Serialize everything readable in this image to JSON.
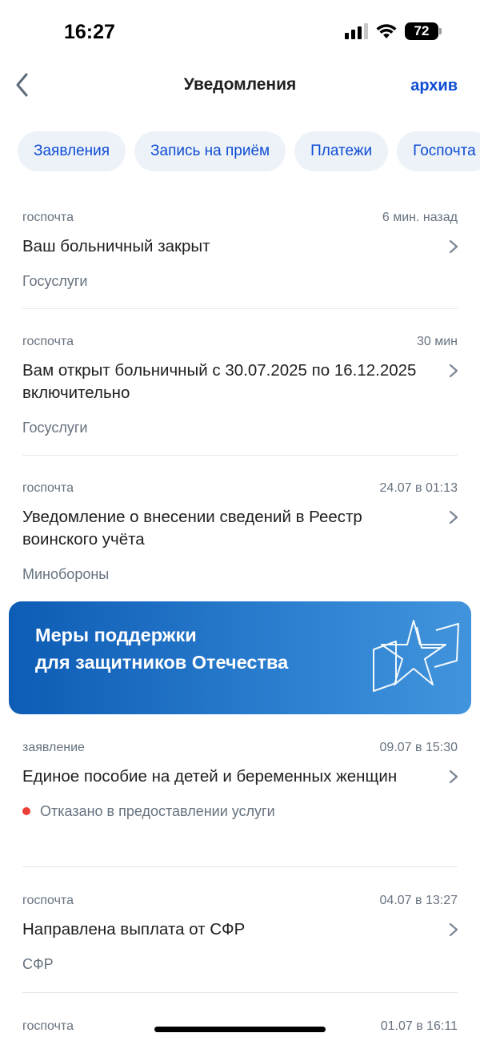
{
  "status_bar": {
    "time": "16:27",
    "battery": "72"
  },
  "nav": {
    "title": "Уведомления",
    "archive_label": "архив"
  },
  "filters": [
    "Заявления",
    "Запись на приём",
    "Платежи",
    "Госпочта"
  ],
  "notifications": [
    {
      "type": "госпочта",
      "time": "6 мин. назад",
      "title": "Ваш больничный закрыт",
      "sender": "Госуслуги"
    },
    {
      "type": "госпочта",
      "time": "30 мин",
      "title": "Вам открыт больничный с 30.07.2025 по 16.12.2025 включительно",
      "sender": "Госуслуги"
    },
    {
      "type": "госпочта",
      "time": "24.07 в 01:13",
      "title": "Уведомление о внесении сведений в Реестр воинского учёта",
      "sender": "Минобороны"
    },
    {
      "type": "заявление",
      "time": "09.07 в 15:30",
      "title": "Единое пособие на детей и беременных женщин",
      "status": "Отказано в предоставлении услуги",
      "status_color": "#ee3f36"
    },
    {
      "type": "госпочта",
      "time": "04.07 в 13:27",
      "title": "Направлена выплата от СФР",
      "sender": "СФР"
    },
    {
      "type": "госпочта",
      "time": "01.07 в 16:11"
    }
  ],
  "banner": {
    "line1": "Меры поддержки",
    "line2": "для защитников Отечества"
  },
  "colors": {
    "accent": "#0d4cd3",
    "chip_bg": "#edf2f9",
    "banner_start": "#0d5cb5",
    "banner_end": "#4194dc"
  }
}
